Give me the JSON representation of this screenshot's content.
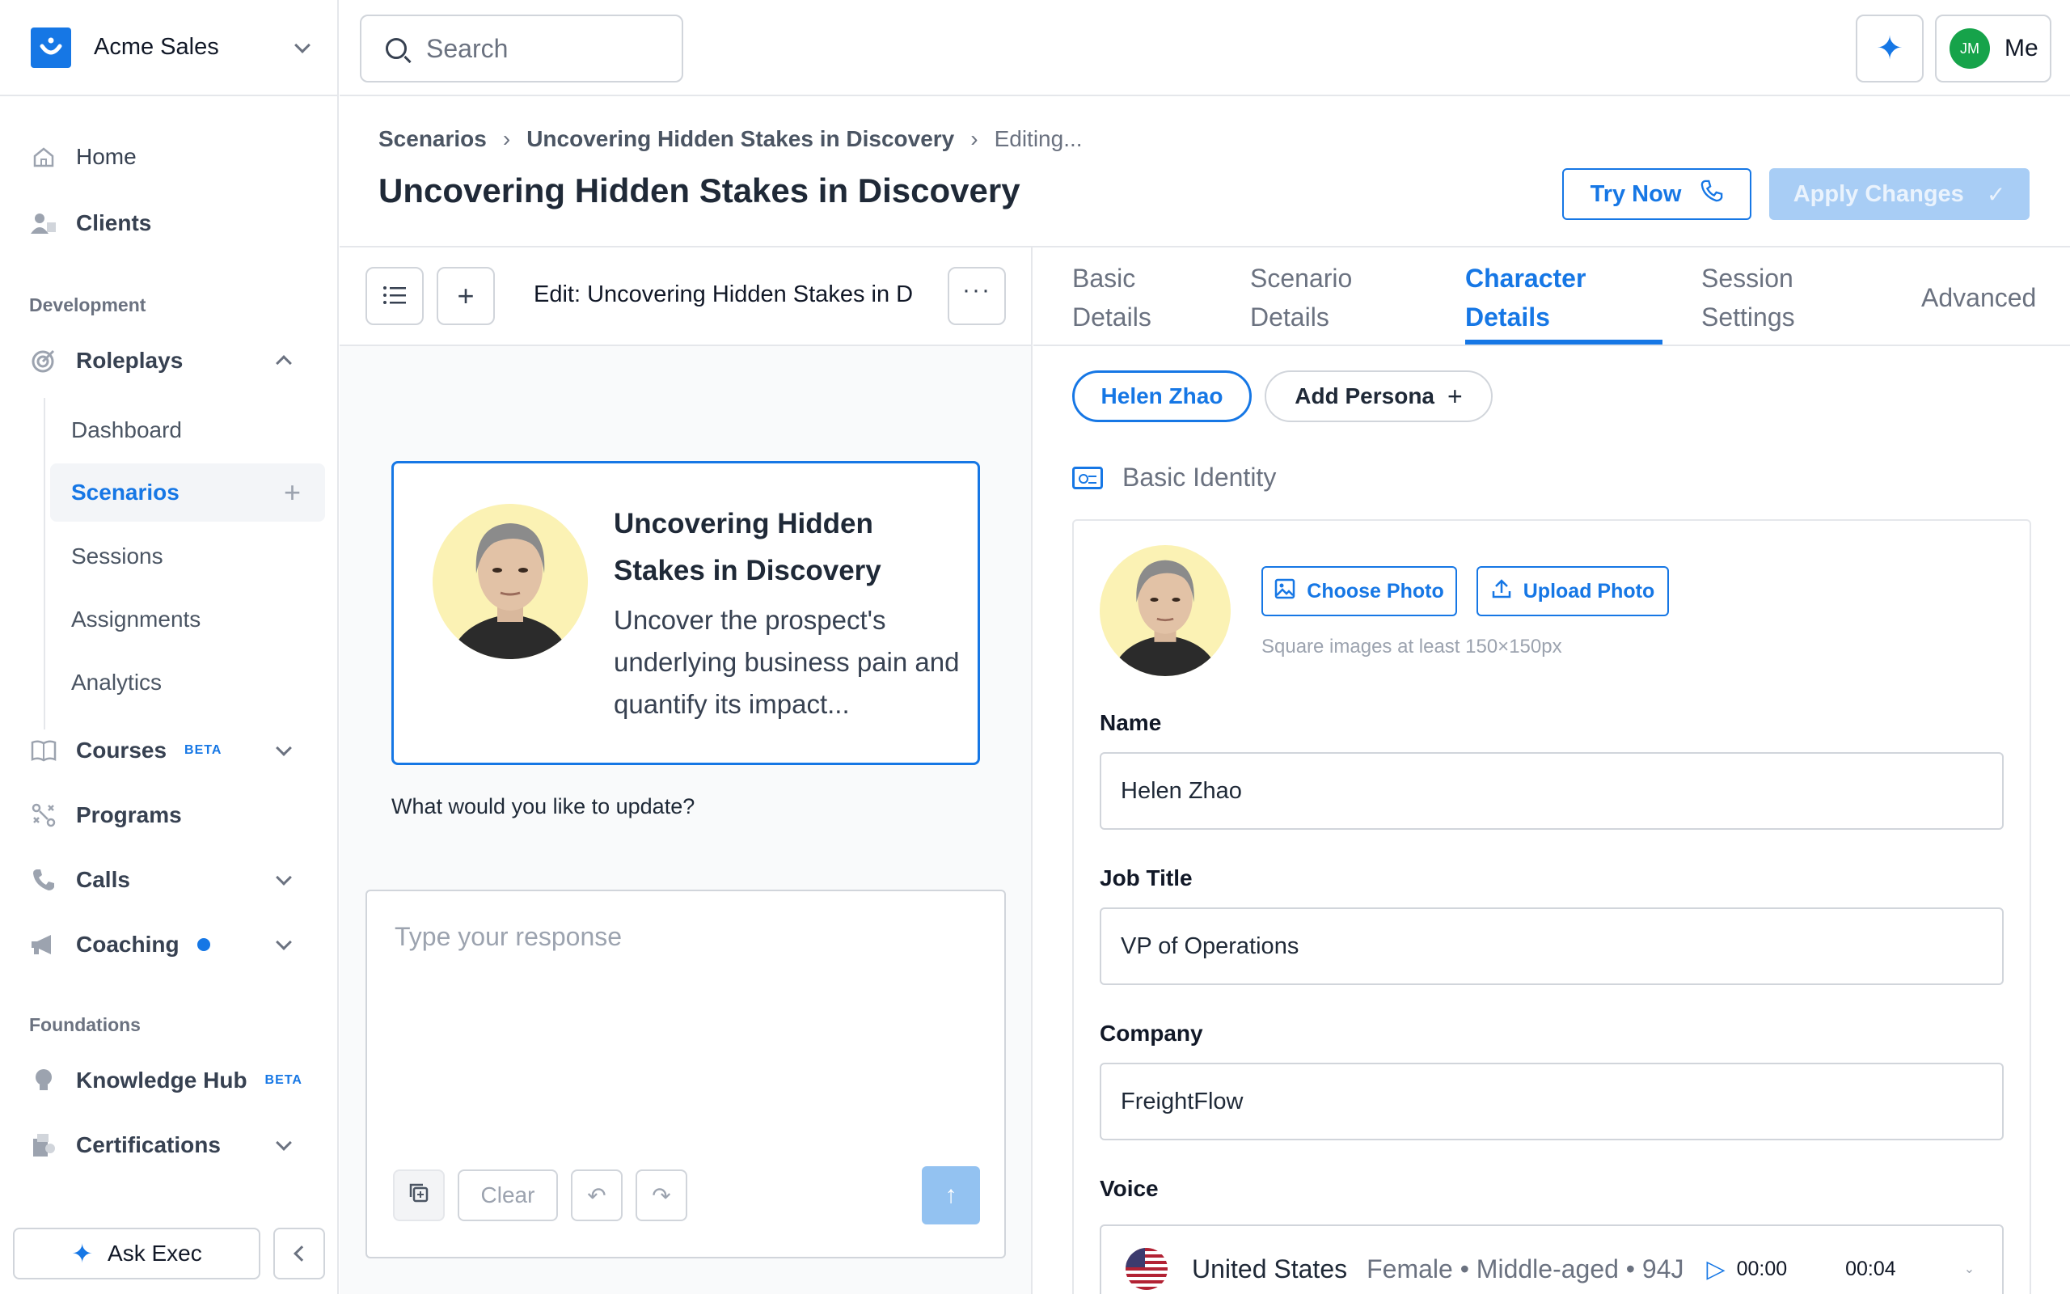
{
  "org": {
    "name": "Acme Sales"
  },
  "sidebar": {
    "home": "Home",
    "clients": "Clients",
    "development_label": "Development",
    "roleplays": "Roleplays",
    "roleplay_items": [
      "Dashboard",
      "Scenarios",
      "Sessions",
      "Assignments",
      "Analytics"
    ],
    "courses": "Courses",
    "beta": "BETA",
    "programs": "Programs",
    "calls": "Calls",
    "coaching": "Coaching",
    "foundations_label": "Foundations",
    "knowledge_hub": "Knowledge Hub",
    "certifications": "Certifications",
    "ask_exec": "Ask Exec"
  },
  "topbar": {
    "search_placeholder": "Search",
    "avatar_initials": "JM",
    "me_label": "Me"
  },
  "header": {
    "breadcrumb": [
      "Scenarios",
      "Uncovering Hidden Stakes in Discovery",
      "Editing..."
    ],
    "title": "Uncovering Hidden Stakes in Discovery",
    "try_now": "Try Now",
    "apply_changes": "Apply Changes"
  },
  "editor": {
    "edit_title": "Edit: Uncovering Hidden Stakes in D",
    "card_title": "Uncovering Hidden Stakes in Discovery",
    "card_description": "Uncover the prospect's underlying business pain and quantify its impact...",
    "prompt": "What would you like to update?",
    "response_placeholder": "Type your response",
    "clear": "Clear"
  },
  "tabs": [
    {
      "label": "Basic Details",
      "active": false
    },
    {
      "label": "Scenario Details",
      "active": false
    },
    {
      "label": "Character Details",
      "active": true
    },
    {
      "label": "Session Settings",
      "active": false
    },
    {
      "label": "Advanced",
      "active": false
    }
  ],
  "personas": {
    "active": "Helen Zhao",
    "add": "Add Persona"
  },
  "identity": {
    "section_title": "Basic Identity",
    "choose_photo": "Choose Photo",
    "upload_photo": "Upload Photo",
    "photo_hint": "Square images at least 150×150px",
    "name_label": "Name",
    "name_value": "Helen Zhao",
    "job_title_label": "Job Title",
    "job_title_value": "VP of Operations",
    "company_label": "Company",
    "company_value": "FreightFlow",
    "voice_label": "Voice",
    "voice_country": "United States",
    "voice_meta": "Female • Middle-aged • 94J",
    "voice_time_start": "00:00",
    "voice_time_end": "00:04"
  },
  "colors": {
    "accent": "#1677e5",
    "apply_disabled": "#a8cdf5",
    "avatar_green": "#16a34a"
  }
}
